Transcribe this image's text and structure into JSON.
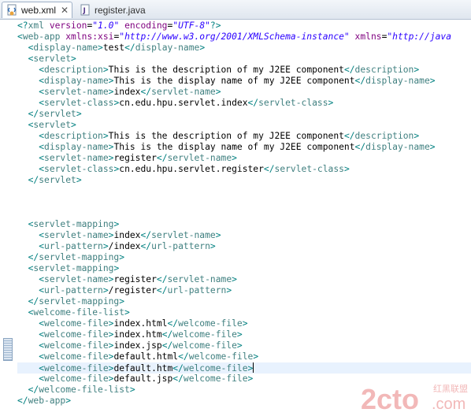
{
  "tabs": [
    {
      "label": "web.xml",
      "icon": "xml-file-icon",
      "active": true
    },
    {
      "label": "register.java",
      "icon": "java-file-icon",
      "active": false
    }
  ],
  "colors": {
    "tag": "#3f7f7f",
    "bracket": "#008080",
    "attribute": "#7f007f",
    "attribute_value": "#2a00ff",
    "text": "#000000",
    "current_line": "#e8f2fe"
  },
  "editor": {
    "current_line_index": 31,
    "lines": [
      [
        {
          "k": "punc",
          "s": "<?"
        },
        {
          "k": "tag",
          "s": "xml "
        },
        {
          "k": "attr",
          "s": "version"
        },
        {
          "k": "text",
          "s": "="
        },
        {
          "k": "val",
          "s": "\"1.0\""
        },
        {
          "k": "text",
          "s": " "
        },
        {
          "k": "attr",
          "s": "encoding"
        },
        {
          "k": "text",
          "s": "="
        },
        {
          "k": "val",
          "s": "\"UTF-8\""
        },
        {
          "k": "punc",
          "s": "?>"
        }
      ],
      [
        {
          "k": "punc",
          "s": "<"
        },
        {
          "k": "tag",
          "s": "web-app "
        },
        {
          "k": "attr",
          "s": "xmlns:xsi"
        },
        {
          "k": "text",
          "s": "="
        },
        {
          "k": "val",
          "s": "\"http://www.w3.org/2001/XMLSchema-instance\""
        },
        {
          "k": "text",
          "s": " "
        },
        {
          "k": "attr",
          "s": "xmlns"
        },
        {
          "k": "text",
          "s": "="
        },
        {
          "k": "val",
          "s": "\"http://java"
        }
      ],
      [
        {
          "k": "text",
          "s": "  "
        },
        {
          "k": "punc",
          "s": "<"
        },
        {
          "k": "tag",
          "s": "display-name"
        },
        {
          "k": "punc",
          "s": ">"
        },
        {
          "k": "text",
          "s": "test"
        },
        {
          "k": "punc",
          "s": "</"
        },
        {
          "k": "tag",
          "s": "display-name"
        },
        {
          "k": "punc",
          "s": ">"
        }
      ],
      [
        {
          "k": "text",
          "s": "  "
        },
        {
          "k": "punc",
          "s": "<"
        },
        {
          "k": "tag",
          "s": "servlet"
        },
        {
          "k": "punc",
          "s": ">"
        }
      ],
      [
        {
          "k": "text",
          "s": "    "
        },
        {
          "k": "punc",
          "s": "<"
        },
        {
          "k": "tag",
          "s": "description"
        },
        {
          "k": "punc",
          "s": ">"
        },
        {
          "k": "text",
          "s": "This is the description of my J2EE component"
        },
        {
          "k": "punc",
          "s": "</"
        },
        {
          "k": "tag",
          "s": "description"
        },
        {
          "k": "punc",
          "s": ">"
        }
      ],
      [
        {
          "k": "text",
          "s": "    "
        },
        {
          "k": "punc",
          "s": "<"
        },
        {
          "k": "tag",
          "s": "display-name"
        },
        {
          "k": "punc",
          "s": ">"
        },
        {
          "k": "text",
          "s": "This is the display name of my J2EE component"
        },
        {
          "k": "punc",
          "s": "</"
        },
        {
          "k": "tag",
          "s": "display-name"
        },
        {
          "k": "punc",
          "s": ">"
        }
      ],
      [
        {
          "k": "text",
          "s": "    "
        },
        {
          "k": "punc",
          "s": "<"
        },
        {
          "k": "tag",
          "s": "servlet-name"
        },
        {
          "k": "punc",
          "s": ">"
        },
        {
          "k": "text",
          "s": "index"
        },
        {
          "k": "punc",
          "s": "</"
        },
        {
          "k": "tag",
          "s": "servlet-name"
        },
        {
          "k": "punc",
          "s": ">"
        }
      ],
      [
        {
          "k": "text",
          "s": "    "
        },
        {
          "k": "punc",
          "s": "<"
        },
        {
          "k": "tag",
          "s": "servlet-class"
        },
        {
          "k": "punc",
          "s": ">"
        },
        {
          "k": "text",
          "s": "cn.edu.hpu.servlet.index"
        },
        {
          "k": "punc",
          "s": "</"
        },
        {
          "k": "tag",
          "s": "servlet-class"
        },
        {
          "k": "punc",
          "s": ">"
        }
      ],
      [
        {
          "k": "text",
          "s": "  "
        },
        {
          "k": "punc",
          "s": "</"
        },
        {
          "k": "tag",
          "s": "servlet"
        },
        {
          "k": "punc",
          "s": ">"
        }
      ],
      [
        {
          "k": "text",
          "s": "  "
        },
        {
          "k": "punc",
          "s": "<"
        },
        {
          "k": "tag",
          "s": "servlet"
        },
        {
          "k": "punc",
          "s": ">"
        }
      ],
      [
        {
          "k": "text",
          "s": "    "
        },
        {
          "k": "punc",
          "s": "<"
        },
        {
          "k": "tag",
          "s": "description"
        },
        {
          "k": "punc",
          "s": ">"
        },
        {
          "k": "text",
          "s": "This is the description of my J2EE component"
        },
        {
          "k": "punc",
          "s": "</"
        },
        {
          "k": "tag",
          "s": "description"
        },
        {
          "k": "punc",
          "s": ">"
        }
      ],
      [
        {
          "k": "text",
          "s": "    "
        },
        {
          "k": "punc",
          "s": "<"
        },
        {
          "k": "tag",
          "s": "display-name"
        },
        {
          "k": "punc",
          "s": ">"
        },
        {
          "k": "text",
          "s": "This is the display name of my J2EE component"
        },
        {
          "k": "punc",
          "s": "</"
        },
        {
          "k": "tag",
          "s": "display-name"
        },
        {
          "k": "punc",
          "s": ">"
        }
      ],
      [
        {
          "k": "text",
          "s": "    "
        },
        {
          "k": "punc",
          "s": "<"
        },
        {
          "k": "tag",
          "s": "servlet-name"
        },
        {
          "k": "punc",
          "s": ">"
        },
        {
          "k": "text",
          "s": "register"
        },
        {
          "k": "punc",
          "s": "</"
        },
        {
          "k": "tag",
          "s": "servlet-name"
        },
        {
          "k": "punc",
          "s": ">"
        }
      ],
      [
        {
          "k": "text",
          "s": "    "
        },
        {
          "k": "punc",
          "s": "<"
        },
        {
          "k": "tag",
          "s": "servlet-class"
        },
        {
          "k": "punc",
          "s": ">"
        },
        {
          "k": "text",
          "s": "cn.edu.hpu.servlet.register"
        },
        {
          "k": "punc",
          "s": "</"
        },
        {
          "k": "tag",
          "s": "servlet-class"
        },
        {
          "k": "punc",
          "s": ">"
        }
      ],
      [
        {
          "k": "text",
          "s": "  "
        },
        {
          "k": "punc",
          "s": "</"
        },
        {
          "k": "tag",
          "s": "servlet"
        },
        {
          "k": "punc",
          "s": ">"
        }
      ],
      [],
      [],
      [],
      [
        {
          "k": "text",
          "s": "  "
        },
        {
          "k": "punc",
          "s": "<"
        },
        {
          "k": "tag",
          "s": "servlet-mapping"
        },
        {
          "k": "punc",
          "s": ">"
        }
      ],
      [
        {
          "k": "text",
          "s": "    "
        },
        {
          "k": "punc",
          "s": "<"
        },
        {
          "k": "tag",
          "s": "servlet-name"
        },
        {
          "k": "punc",
          "s": ">"
        },
        {
          "k": "text",
          "s": "index"
        },
        {
          "k": "punc",
          "s": "</"
        },
        {
          "k": "tag",
          "s": "servlet-name"
        },
        {
          "k": "punc",
          "s": ">"
        }
      ],
      [
        {
          "k": "text",
          "s": "    "
        },
        {
          "k": "punc",
          "s": "<"
        },
        {
          "k": "tag",
          "s": "url-pattern"
        },
        {
          "k": "punc",
          "s": ">"
        },
        {
          "k": "text",
          "s": "/index"
        },
        {
          "k": "punc",
          "s": "</"
        },
        {
          "k": "tag",
          "s": "url-pattern"
        },
        {
          "k": "punc",
          "s": ">"
        }
      ],
      [
        {
          "k": "text",
          "s": "  "
        },
        {
          "k": "punc",
          "s": "</"
        },
        {
          "k": "tag",
          "s": "servlet-mapping"
        },
        {
          "k": "punc",
          "s": ">"
        }
      ],
      [
        {
          "k": "text",
          "s": "  "
        },
        {
          "k": "punc",
          "s": "<"
        },
        {
          "k": "tag",
          "s": "servlet-mapping"
        },
        {
          "k": "punc",
          "s": ">"
        }
      ],
      [
        {
          "k": "text",
          "s": "    "
        },
        {
          "k": "punc",
          "s": "<"
        },
        {
          "k": "tag",
          "s": "servlet-name"
        },
        {
          "k": "punc",
          "s": ">"
        },
        {
          "k": "text",
          "s": "register"
        },
        {
          "k": "punc",
          "s": "</"
        },
        {
          "k": "tag",
          "s": "servlet-name"
        },
        {
          "k": "punc",
          "s": ">"
        }
      ],
      [
        {
          "k": "text",
          "s": "    "
        },
        {
          "k": "punc",
          "s": "<"
        },
        {
          "k": "tag",
          "s": "url-pattern"
        },
        {
          "k": "punc",
          "s": ">"
        },
        {
          "k": "text",
          "s": "/register"
        },
        {
          "k": "punc",
          "s": "</"
        },
        {
          "k": "tag",
          "s": "url-pattern"
        },
        {
          "k": "punc",
          "s": ">"
        }
      ],
      [
        {
          "k": "text",
          "s": "  "
        },
        {
          "k": "punc",
          "s": "</"
        },
        {
          "k": "tag",
          "s": "servlet-mapping"
        },
        {
          "k": "punc",
          "s": ">"
        }
      ],
      [
        {
          "k": "text",
          "s": "  "
        },
        {
          "k": "punc",
          "s": "<"
        },
        {
          "k": "tag",
          "s": "welcome-file-list"
        },
        {
          "k": "punc",
          "s": ">"
        }
      ],
      [
        {
          "k": "text",
          "s": "    "
        },
        {
          "k": "punc",
          "s": "<"
        },
        {
          "k": "tag",
          "s": "welcome-file"
        },
        {
          "k": "punc",
          "s": ">"
        },
        {
          "k": "text",
          "s": "index.html"
        },
        {
          "k": "punc",
          "s": "</"
        },
        {
          "k": "tag",
          "s": "welcome-file"
        },
        {
          "k": "punc",
          "s": ">"
        }
      ],
      [
        {
          "k": "text",
          "s": "    "
        },
        {
          "k": "punc",
          "s": "<"
        },
        {
          "k": "tag",
          "s": "welcome-file"
        },
        {
          "k": "punc",
          "s": ">"
        },
        {
          "k": "text",
          "s": "index.htm"
        },
        {
          "k": "punc",
          "s": "</"
        },
        {
          "k": "tag",
          "s": "welcome-file"
        },
        {
          "k": "punc",
          "s": ">"
        }
      ],
      [
        {
          "k": "text",
          "s": "    "
        },
        {
          "k": "punc",
          "s": "<"
        },
        {
          "k": "tag",
          "s": "welcome-file"
        },
        {
          "k": "punc",
          "s": ">"
        },
        {
          "k": "text",
          "s": "index.jsp"
        },
        {
          "k": "punc",
          "s": "</"
        },
        {
          "k": "tag",
          "s": "welcome-file"
        },
        {
          "k": "punc",
          "s": ">"
        }
      ],
      [
        {
          "k": "text",
          "s": "    "
        },
        {
          "k": "punc",
          "s": "<"
        },
        {
          "k": "tag",
          "s": "welcome-file"
        },
        {
          "k": "punc",
          "s": ">"
        },
        {
          "k": "text",
          "s": "default.html"
        },
        {
          "k": "punc",
          "s": "</"
        },
        {
          "k": "tag",
          "s": "welcome-file"
        },
        {
          "k": "punc",
          "s": ">"
        }
      ],
      [
        {
          "k": "text",
          "s": "    "
        },
        {
          "k": "punc",
          "s": "<"
        },
        {
          "k": "tag",
          "s": "welcome-file"
        },
        {
          "k": "punc",
          "s": ">"
        },
        {
          "k": "text",
          "s": "default.htm"
        },
        {
          "k": "punc",
          "s": "</"
        },
        {
          "k": "tag",
          "s": "welcome-file"
        },
        {
          "k": "punc",
          "s": ">"
        }
      ],
      [
        {
          "k": "text",
          "s": "    "
        },
        {
          "k": "punc",
          "s": "<"
        },
        {
          "k": "tag",
          "s": "welcome-file"
        },
        {
          "k": "punc",
          "s": ">"
        },
        {
          "k": "text",
          "s": "default.jsp"
        },
        {
          "k": "punc",
          "s": "</"
        },
        {
          "k": "tag",
          "s": "welcome-file"
        },
        {
          "k": "punc",
          "s": ">"
        }
      ],
      [
        {
          "k": "text",
          "s": "  "
        },
        {
          "k": "punc",
          "s": "</"
        },
        {
          "k": "tag",
          "s": "welcome-file-list"
        },
        {
          "k": "punc",
          "s": ">"
        }
      ],
      [
        {
          "k": "punc",
          "s": "</"
        },
        {
          "k": "tag",
          "s": "web-app"
        },
        {
          "k": "punc",
          "s": ">"
        }
      ]
    ]
  },
  "watermark": {
    "main": "2cto",
    "suffix": ".com",
    "cn": "红黑联盟"
  }
}
